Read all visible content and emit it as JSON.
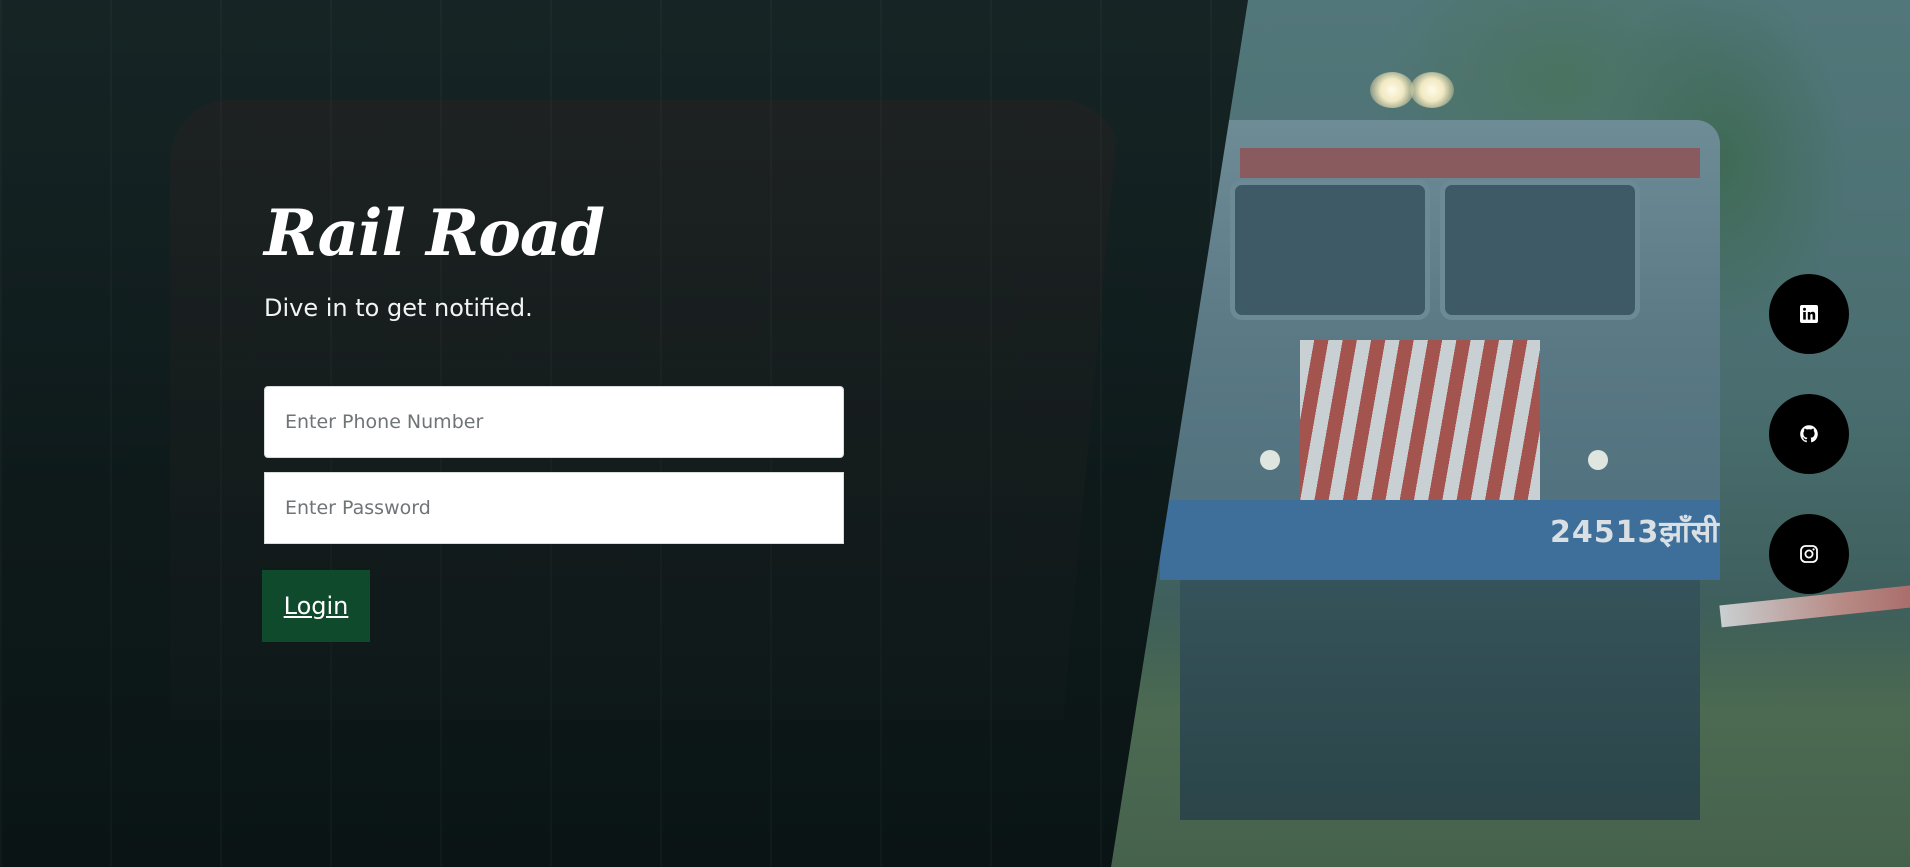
{
  "brand": {
    "title": "Rail Road",
    "tagline": "Dive in to get notified."
  },
  "form": {
    "phone_placeholder": "Enter Phone Number",
    "phone_value": "",
    "password_placeholder": "Enter Password",
    "password_value": "",
    "login_label": "Login"
  },
  "background": {
    "loco_number": "24513झाँसी"
  },
  "social": [
    {
      "icon": "linkedin-icon"
    },
    {
      "icon": "github-icon"
    },
    {
      "icon": "instagram-icon"
    }
  ],
  "colors": {
    "login_button": "#0f4a2c",
    "social_button": "#000000",
    "overlay": "#0e1a1b"
  }
}
